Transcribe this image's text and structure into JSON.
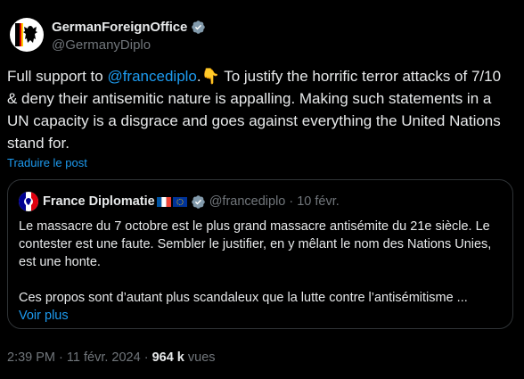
{
  "tweet": {
    "author_name": "GermanForeignOffice",
    "author_handle": "@GermanyDiplo",
    "text_before_mention": "Full support to ",
    "mention": "@francediplo",
    "text_after_mention": ".👇 To justify the horrific terror attacks of 7/10 & deny their antisemitic nature is appalling. Making such statements in a UN capacity is a disgrace and goes against everything the United Nations stand for.",
    "translate_label": "Traduire le post",
    "time": "2:39 PM",
    "date": "11 févr. 2024",
    "separator": " · ",
    "views_count": "964 k",
    "views_label": "vues"
  },
  "quote": {
    "author_name": "France Diplomatie",
    "author_handle": "@francediplo",
    "date": "· 10 févr.",
    "paragraph1": "Le massacre du 7 octobre est le plus grand massacre antisémite du 21e siècle. Le contester est une faute. Sembler le justifier, en y mêlant le nom des Nations Unies, est une honte.",
    "paragraph2": "Ces propos sont d’autant plus scandaleux que la lutte contre l’antisémitisme ...",
    "see_more": "Voir plus"
  },
  "icons": {
    "verified": "verified-badge-icon",
    "eagle": "german-eagle-logo",
    "marianne": "marianne-logo",
    "flag_fr": "french-flag-icon",
    "flag_eu": "eu-flag-icon"
  },
  "colors": {
    "background": "#000000",
    "text": "#e7e9ea",
    "muted": "#71767b",
    "link": "#1d9bf0",
    "border": "#2f3336"
  }
}
